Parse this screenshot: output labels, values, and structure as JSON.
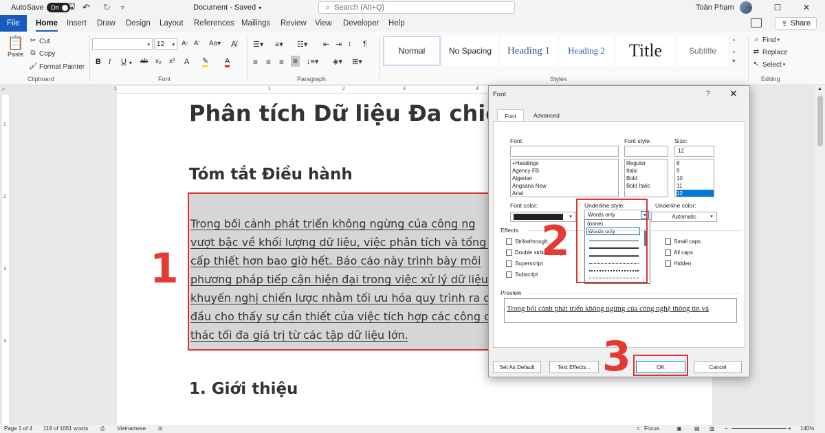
{
  "titlebar": {
    "autosave_label": "AutoSave",
    "autosave_state": "On",
    "doc_title": "Document - Saved",
    "search_placeholder": "Search (Alt+Q)",
    "user_name": "Toàn Phạm"
  },
  "tabs": [
    "File",
    "Home",
    "Insert",
    "Draw",
    "Design",
    "Layout",
    "References",
    "Mailings",
    "Review",
    "View",
    "Developer",
    "Help"
  ],
  "share_label": "Share",
  "ribbon": {
    "clipboard": {
      "paste": "Paste",
      "cut": "Cut",
      "copy": "Copy",
      "format_painter": "Format Painter",
      "label": "Clipboard"
    },
    "font": {
      "size": "12",
      "label": "Font"
    },
    "paragraph_label": "Paragraph",
    "styles": {
      "items": [
        "Normal",
        "No Spacing",
        "Heading 1",
        "Heading 2",
        "Title",
        "Subtitle"
      ],
      "label": "Styles"
    },
    "editing": {
      "find": "Find",
      "replace": "Replace",
      "select": "Select",
      "label": "Editing"
    }
  },
  "ruler": {
    "h_ticks": [
      "1",
      "1",
      "2",
      "3",
      "4"
    ],
    "v_ticks": [
      "1",
      "2",
      "3",
      "4"
    ]
  },
  "document": {
    "title": "Phân tích Dữ liệu Đa chiều",
    "summary_heading": "Tóm tắt Điều hành",
    "selected_lines": [
      "Trong bối cảnh phát triển không ngừng của công ng",
      "vượt bậc về khối lượng dữ liệu, việc phân tích và tổng hợ",
      "cấp thiết hơn bao giờ hết. Báo cáo này trình bày môi",
      "phương pháp tiếp cận hiện đại trong việc xử lý dữ liệu p",
      "khuyến nghị chiến lược nhằm tối ưu hóa quy trình ra qu",
      "đầu cho thấy sự cần thiết của việc tích hợp các công cụ",
      "thác tối đa giá trị từ các tập dữ liệu lớn."
    ],
    "intro_heading": "1. Giới thiệu"
  },
  "markers": {
    "one": "1",
    "two": "2",
    "three": "3"
  },
  "dialog": {
    "title": "Font",
    "help": "?",
    "close": "✕",
    "tabs": [
      "Font",
      "Advanced"
    ],
    "font_label": "Font:",
    "font_list": [
      "+Headings",
      "Agency FB",
      "Algerian",
      "Angsana New",
      "Arial"
    ],
    "style_label": "Font style:",
    "style_list": [
      "Regular",
      "Italic",
      "Bold",
      "Bold Italic"
    ],
    "size_label": "Size:",
    "size_value": "12",
    "size_list": [
      "8",
      "9",
      "10",
      "11",
      "12"
    ],
    "font_color_label": "Font color:",
    "underline_style_label": "Underline style:",
    "underline_style_value": "Words only",
    "underline_options": [
      "(none)",
      "Words only"
    ],
    "underline_color_label": "Underline color:",
    "underline_color_value": "Automatic",
    "effects_label": "Effects",
    "effects_left": [
      "Strikethrough",
      "Double strikethrough",
      "Superscript",
      "Subscript"
    ],
    "effects_right": [
      "Small caps",
      "All caps",
      "Hidden"
    ],
    "preview_label": "Preview",
    "preview_text": "Trong bối cảnh phát triển không ngừng của công nghệ thông tin và",
    "buttons": {
      "set_default": "Set As Default",
      "text_effects": "Text Effects...",
      "ok": "OK",
      "cancel": "Cancel"
    }
  },
  "statusbar": {
    "page": "Page 1 of 4",
    "words": "119 of 1051 words",
    "language": "Vietnamese",
    "focus": "Focus",
    "zoom": "140%"
  },
  "colors": {
    "accent": "#185abd",
    "marker_red": "#e53935"
  }
}
